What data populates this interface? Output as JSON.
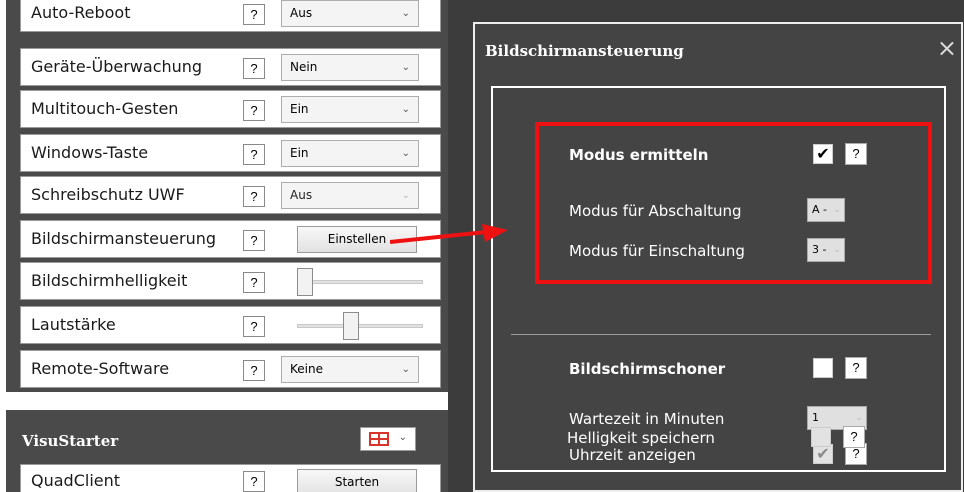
{
  "settings": {
    "rows": [
      {
        "label": "Auto-Reboot",
        "help": "?",
        "value": "Aus",
        "chev": "⌄"
      },
      {
        "label": "Geräte-Überwachung",
        "help": "?",
        "value": "Nein",
        "chev": "⌄"
      },
      {
        "label": "Multitouch-Gesten",
        "help": "?",
        "value": "Ein",
        "chev": "⌄"
      },
      {
        "label": "Windows-Taste",
        "help": "?",
        "value": "Ein",
        "chev": "⌄"
      },
      {
        "label": "Schreibschutz UWF",
        "help": "?",
        "value": "Aus",
        "chev": "⌄"
      },
      {
        "label": "Bildschirmansteuerung",
        "help": "?",
        "button": "Einstellen"
      },
      {
        "label": "Bildschirmhelligkeit",
        "help": "?",
        "slider_level": 0.0
      },
      {
        "label": "Lautstärke",
        "help": "?",
        "slider_level": 0.4
      },
      {
        "label": "Remote-Software",
        "help": "?",
        "value": "Keine",
        "chev": "⌄"
      }
    ]
  },
  "visustarter": {
    "title": "VisuStarter",
    "icon": "window-layout-icon",
    "chev": "⌄",
    "row": {
      "label": "QuadClient",
      "help": "?",
      "button": "Starten"
    }
  },
  "dialog": {
    "title": "Bildschirmansteuerung",
    "close_glyph": "⨯",
    "modus_ermitteln": {
      "label": "Modus ermitteln",
      "checked": true,
      "check_glyph": "✔",
      "help": "?"
    },
    "abschaltung": {
      "label": "Modus für Abschaltung",
      "value": "A -",
      "chev": "⌄"
    },
    "einschaltung": {
      "label": "Modus für Einschaltung",
      "value": "3 -",
      "chev": "⌄"
    },
    "bildschirmschoner": {
      "label": "Bildschirmschoner",
      "checked": false,
      "help": "?"
    },
    "wartezeit": {
      "label": "Wartezeit in Minuten",
      "value": "1",
      "chev": "⌄"
    },
    "uhrzeit": {
      "label": "Uhrzeit anzeigen",
      "checked": true,
      "check_glyph": "✔",
      "help": "?"
    },
    "helligkeit": {
      "label": "Helligkeit speichern",
      "checked": false,
      "help": "?"
    }
  },
  "colors": {
    "panel": "#4a4a4a",
    "dialog": "#444444",
    "highlight": "#ee1111",
    "layout_icon": "#d9342b"
  }
}
